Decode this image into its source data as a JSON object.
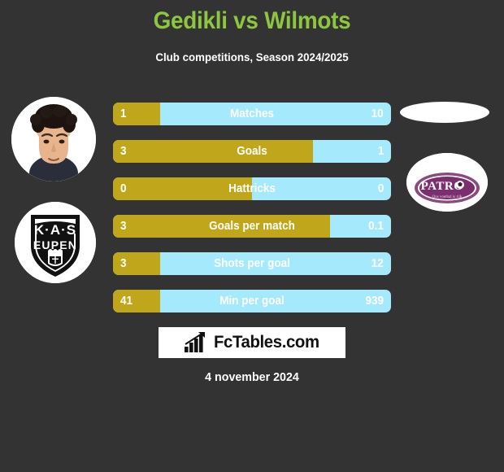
{
  "header": {
    "title": "Gedikli vs Wilmots",
    "subtitle": "Club competitions, Season 2024/2025",
    "title_color": "#8DC63F"
  },
  "colors": {
    "background": "#333333",
    "home_bar": "#BFA61A",
    "away_bar": "#A5E9FC",
    "text": "#FFFFFF",
    "accent_green": "#8DC63F",
    "badge_purple": "#7C2F6E"
  },
  "left_player": {
    "photo_name": "player-portrait-gedikli",
    "club_badge_name": "kas-eupen-badge",
    "club_badge_text_top": "K·A·S",
    "club_badge_text_bottom": "EUPEN"
  },
  "right_player": {
    "photo_name": "player-portrait-wilmots",
    "club_badge_name": "patro-eisden-badge",
    "club_badge_text": "PATRO"
  },
  "stats": [
    {
      "label": "Matches",
      "home": "1",
      "away": "10",
      "home_pct": 17
    },
    {
      "label": "Goals",
      "home": "3",
      "away": "1",
      "home_pct": 72
    },
    {
      "label": "Hattricks",
      "home": "0",
      "away": "0",
      "home_pct": 50
    },
    {
      "label": "Goals per match",
      "home": "3",
      "away": "0.1",
      "home_pct": 78
    },
    {
      "label": "Shots per goal",
      "home": "3",
      "away": "12",
      "home_pct": 17
    },
    {
      "label": "Min per goal",
      "home": "41",
      "away": "939",
      "home_pct": 17
    }
  ],
  "footer": {
    "brand": "FcTables.com",
    "brand_icon": "bar-chart-icon",
    "date": "4 november 2024"
  }
}
